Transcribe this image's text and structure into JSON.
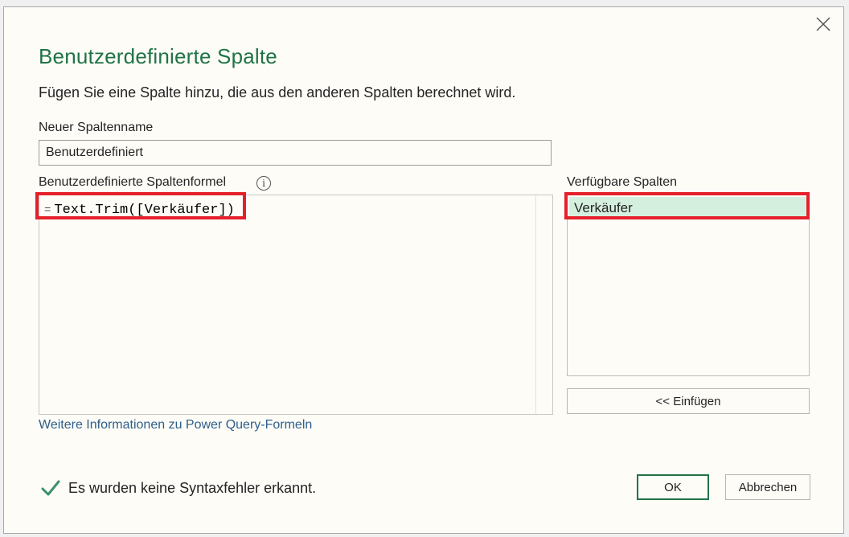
{
  "dialog": {
    "title": "Benutzerdefinierte Spalte",
    "subtitle": "Fügen Sie eine Spalte hinzu, die aus den anderen Spalten berechnet wird.",
    "close_icon": "close-icon"
  },
  "new_column": {
    "label": "Neuer Spaltenname",
    "value": "Benutzerdefiniert"
  },
  "formula": {
    "label": "Benutzerdefinierte Spaltenformel",
    "info_icon": "info-icon",
    "info_glyph": "i",
    "prefix": "=",
    "expression": "Text.Trim([Verkäufer])"
  },
  "available_columns": {
    "label": "Verfügbare Spalten",
    "items": [
      "Verkäufer"
    ],
    "insert_button": "<< Einfügen"
  },
  "help_link": "Weitere Informationen zu Power Query-Formeln",
  "status": {
    "icon": "check-icon",
    "text": "Es wurden keine Syntaxfehler erkannt."
  },
  "buttons": {
    "ok": "OK",
    "cancel": "Abbrechen"
  },
  "colors": {
    "accent": "#217346",
    "highlight_border": "#e5202a",
    "selected_item": "#d5efdf",
    "link": "#2e5f8a"
  }
}
